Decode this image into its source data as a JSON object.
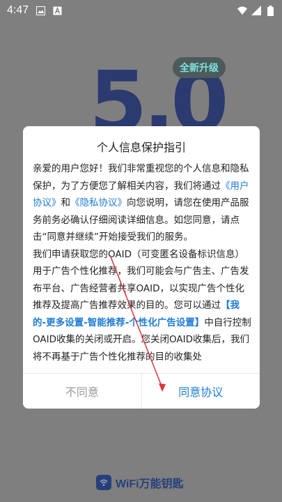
{
  "status_bar": {
    "time": "4:47",
    "left_icons": [
      "image-icon",
      "a-icon"
    ],
    "right_icons": [
      "wifi-icon",
      "cellular-icon",
      "battery-icon"
    ]
  },
  "splash": {
    "version_badge": "5.0",
    "bubble_text": "全新升级",
    "brand_name": "WiFi万能钥匙"
  },
  "dialog": {
    "title": "个人信息保护指引",
    "body": {
      "p1_before": "亲爱的用户您好！我们非常重视您的个人信息和隐私保护，为了方便您了解相关内容，我们将通过",
      "user_agreement": "《用户协议》",
      "and": "和",
      "privacy_agreement": "《隐私协议》",
      "p1_after": "向您说明，请您在使用产品服务前务必确认仔细阅读详细信息。如您同意，请点击“同意并继续”开始接受我们的服务。",
      "p2_before": "我们申请获取您的OAID（可变匿名设备标识信息）用于广告个性化推荐，我们可能会与广告主、广告发布平台、广告经营者共享OAID，以实现广告个性化推荐及提高广告推荐效果的目的。您可以通过",
      "setting_path": "【我的-更多设置-智能推荐-个性化广告设置】",
      "p2_after": "中自行控制OAID收集的关闭或开启。您关闭OAID收集后，我们将不再基于广告个性化推荐的目的收集处"
    },
    "disagree_label": "不同意",
    "agree_label": "同意协议"
  },
  "colors": {
    "accent": "#1f7bd6",
    "annotation": "#d9363e"
  }
}
